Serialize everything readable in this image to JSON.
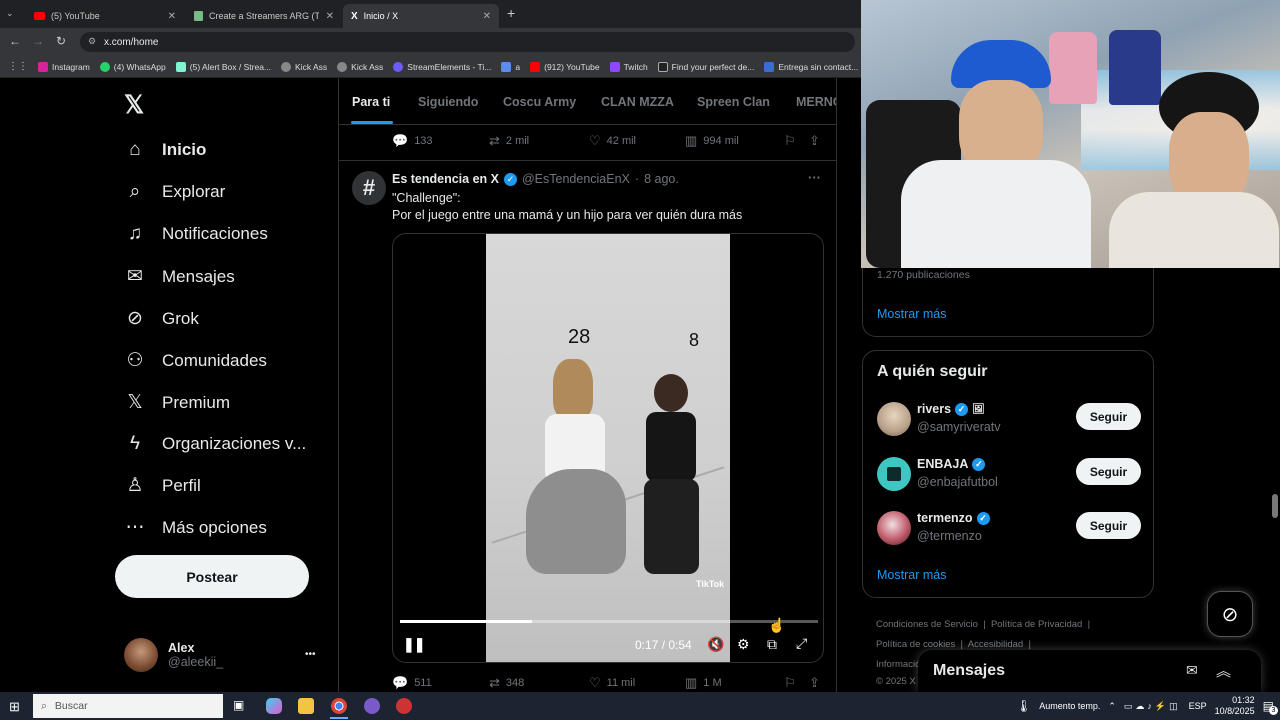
{
  "browser": {
    "tabs": [
      {
        "label": "(5) YouTube",
        "close": "✕"
      },
      {
        "label": "Create a Streamers ARG (Twitch",
        "close": "✕"
      },
      {
        "label": "Inicio / X",
        "close": "✕"
      }
    ],
    "new_tab": "+",
    "url": "x.com/home",
    "bookmarks": [
      "Instagram",
      "(4) WhatsApp",
      "(5) Alert Box / Strea...",
      "Kick Ass",
      "Kick Ass",
      "StreamElements - Ti...",
      "a",
      "(912) YouTube",
      "Twitch",
      "Find your perfect de...",
      "Entrega sin contact..."
    ]
  },
  "sidebar": {
    "items": [
      {
        "label": "Inicio",
        "icon": "home-icon"
      },
      {
        "label": "Explorar",
        "icon": "search-icon"
      },
      {
        "label": "Notificaciones",
        "icon": "bell-icon"
      },
      {
        "label": "Mensajes",
        "icon": "mail-icon"
      },
      {
        "label": "Grok",
        "icon": "grok-icon"
      },
      {
        "label": "Comunidades",
        "icon": "people-icon"
      },
      {
        "label": "Premium",
        "icon": "x-logo-icon"
      },
      {
        "label": "Organizaciones v...",
        "icon": "lightning-icon"
      },
      {
        "label": "Perfil",
        "icon": "person-icon"
      },
      {
        "label": "Más opciones",
        "icon": "more-circle-icon"
      }
    ],
    "post_label": "Postear",
    "profile": {
      "name": "Alex",
      "handle": "@aleekii_",
      "more": "•••"
    }
  },
  "feed": {
    "tabs": [
      "Para ti",
      "Siguiendo",
      "Coscu Army",
      "CLAN MZZA",
      "Spreen Clan",
      "MERNO"
    ],
    "prev_actions": {
      "replies": "133",
      "reposts": "2 mil",
      "likes": "42 mil",
      "views": "994 mil"
    },
    "tweet": {
      "avatar_char": "#",
      "name": "Es tendencia en X",
      "handle": "@EsTendenciaEnX",
      "dot": "·",
      "date": "8 ago.",
      "more": "···",
      "line1": "\"Challenge\":",
      "line2": "Por el juego entre una mamá y un hijo para ver quién dura más",
      "video": {
        "label_left": "28",
        "label_right": "8",
        "watermark": "TikTok",
        "time": "0:17 / 0:54",
        "progress": 0.315
      },
      "actions": {
        "replies": "511",
        "reposts": "348",
        "likes": "11 mil",
        "views": "1 M"
      }
    }
  },
  "right": {
    "trend_card": {
      "count": "1.270 publicaciones",
      "more": "Mostrar más"
    },
    "follow_card": {
      "title": "A quién seguir",
      "users": [
        {
          "name": "rivers",
          "handle": "@samyriveratv",
          "button": "Seguir"
        },
        {
          "name": "ENBAJA",
          "handle": "@enbajafutbol",
          "button": "Seguir"
        },
        {
          "name": "termenzo",
          "handle": "@termenzo",
          "button": "Seguir"
        }
      ],
      "more": "Mostrar más"
    },
    "footer": {
      "terms": "Condiciones de Servicio",
      "privacy": "Política de Privacidad",
      "cookies": "Política de cookies",
      "accessibility": "Accesibilidad",
      "info": "Informació",
      "copyright": "© 2025 X C"
    },
    "messages_drawer": "Mensajes"
  },
  "taskbar": {
    "search": "Buscar",
    "weather": "Aumento temp.",
    "lang": "ESP",
    "time": "01:32",
    "date": "10/8/2025",
    "notifications": "3"
  },
  "colors": {
    "accent": "#1d9bf0",
    "border": "#2f3336",
    "muted": "#71767b"
  }
}
